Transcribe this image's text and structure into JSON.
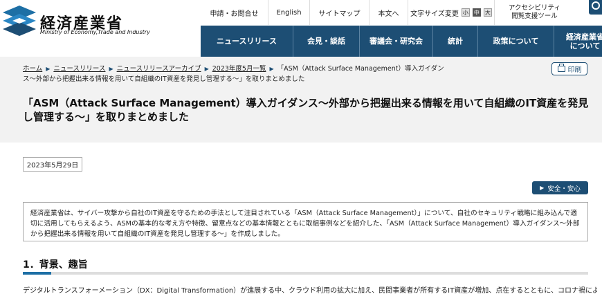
{
  "header": {
    "logo_jp": "経済産業省",
    "logo_en": "Ministry of Economy,Trade and Industry",
    "util_links": [
      "申請・お問合せ",
      "English",
      "サイトマップ",
      "本文へ"
    ],
    "text_size_label": "文字サイズ変更",
    "text_sizes": [
      "小",
      "中",
      "大"
    ],
    "text_size_selected": "中",
    "accessibility_line1": "アクセシビリティ",
    "accessibility_line2": "閲覧支援ツール",
    "nav": [
      "ニュースリリース",
      "会見・談話",
      "審議会・研究会",
      "統計",
      "政策について"
    ],
    "nav_last_line1": "経済産業省",
    "nav_last_line2": "について"
  },
  "breadcrumb": {
    "home": "ホーム",
    "news": "ニュースリリース",
    "archive": "ニュースリリースアーカイブ",
    "month": "2023年度5月一覧",
    "current": "「ASM（Attack Surface Management）導入ガイダンス〜外部から把握出来る情報を用いて自組織のIT資産を発見し管理する〜」を取りまとめました"
  },
  "print_label": "印刷",
  "page_title": "「ASM（Attack Surface Management）導入ガイダンス〜外部から把握出来る情報を用いて自組織のIT資産を発見し管理する〜」を取りまとめました",
  "date": "2023年5月29日",
  "tag": "安全・安心",
  "summary": "経済産業省は、サイバー攻撃から自社のIT資産を守るための手法として注目されている「ASM（Attack Surface Management）」について、自社のセキュリティ戦略に組み込んで適切に活用してもらえるよう、ASMの基本的な考え方や特徴、留意点などの基本情報とともに取組事例などを紹介した、「ASM（Attack Surface Management）導入ガイダンス〜外部から把握出来る情報を用いて自組織のIT資産を発見し管理する〜」を作成しました。",
  "section1_heading": "1．背景、趣旨",
  "section1_body": "デジタルトランスフォーメーション（DX：Digital Transformation）が進展する中、クラウド利用の拡大に加え、民間事業者が所有するIT資産が増加、点在するとともに、コロナ禍によ",
  "colors": {
    "brand": "#1d4e74",
    "accent": "#1d6fa5",
    "band": "#f2f2f2"
  }
}
